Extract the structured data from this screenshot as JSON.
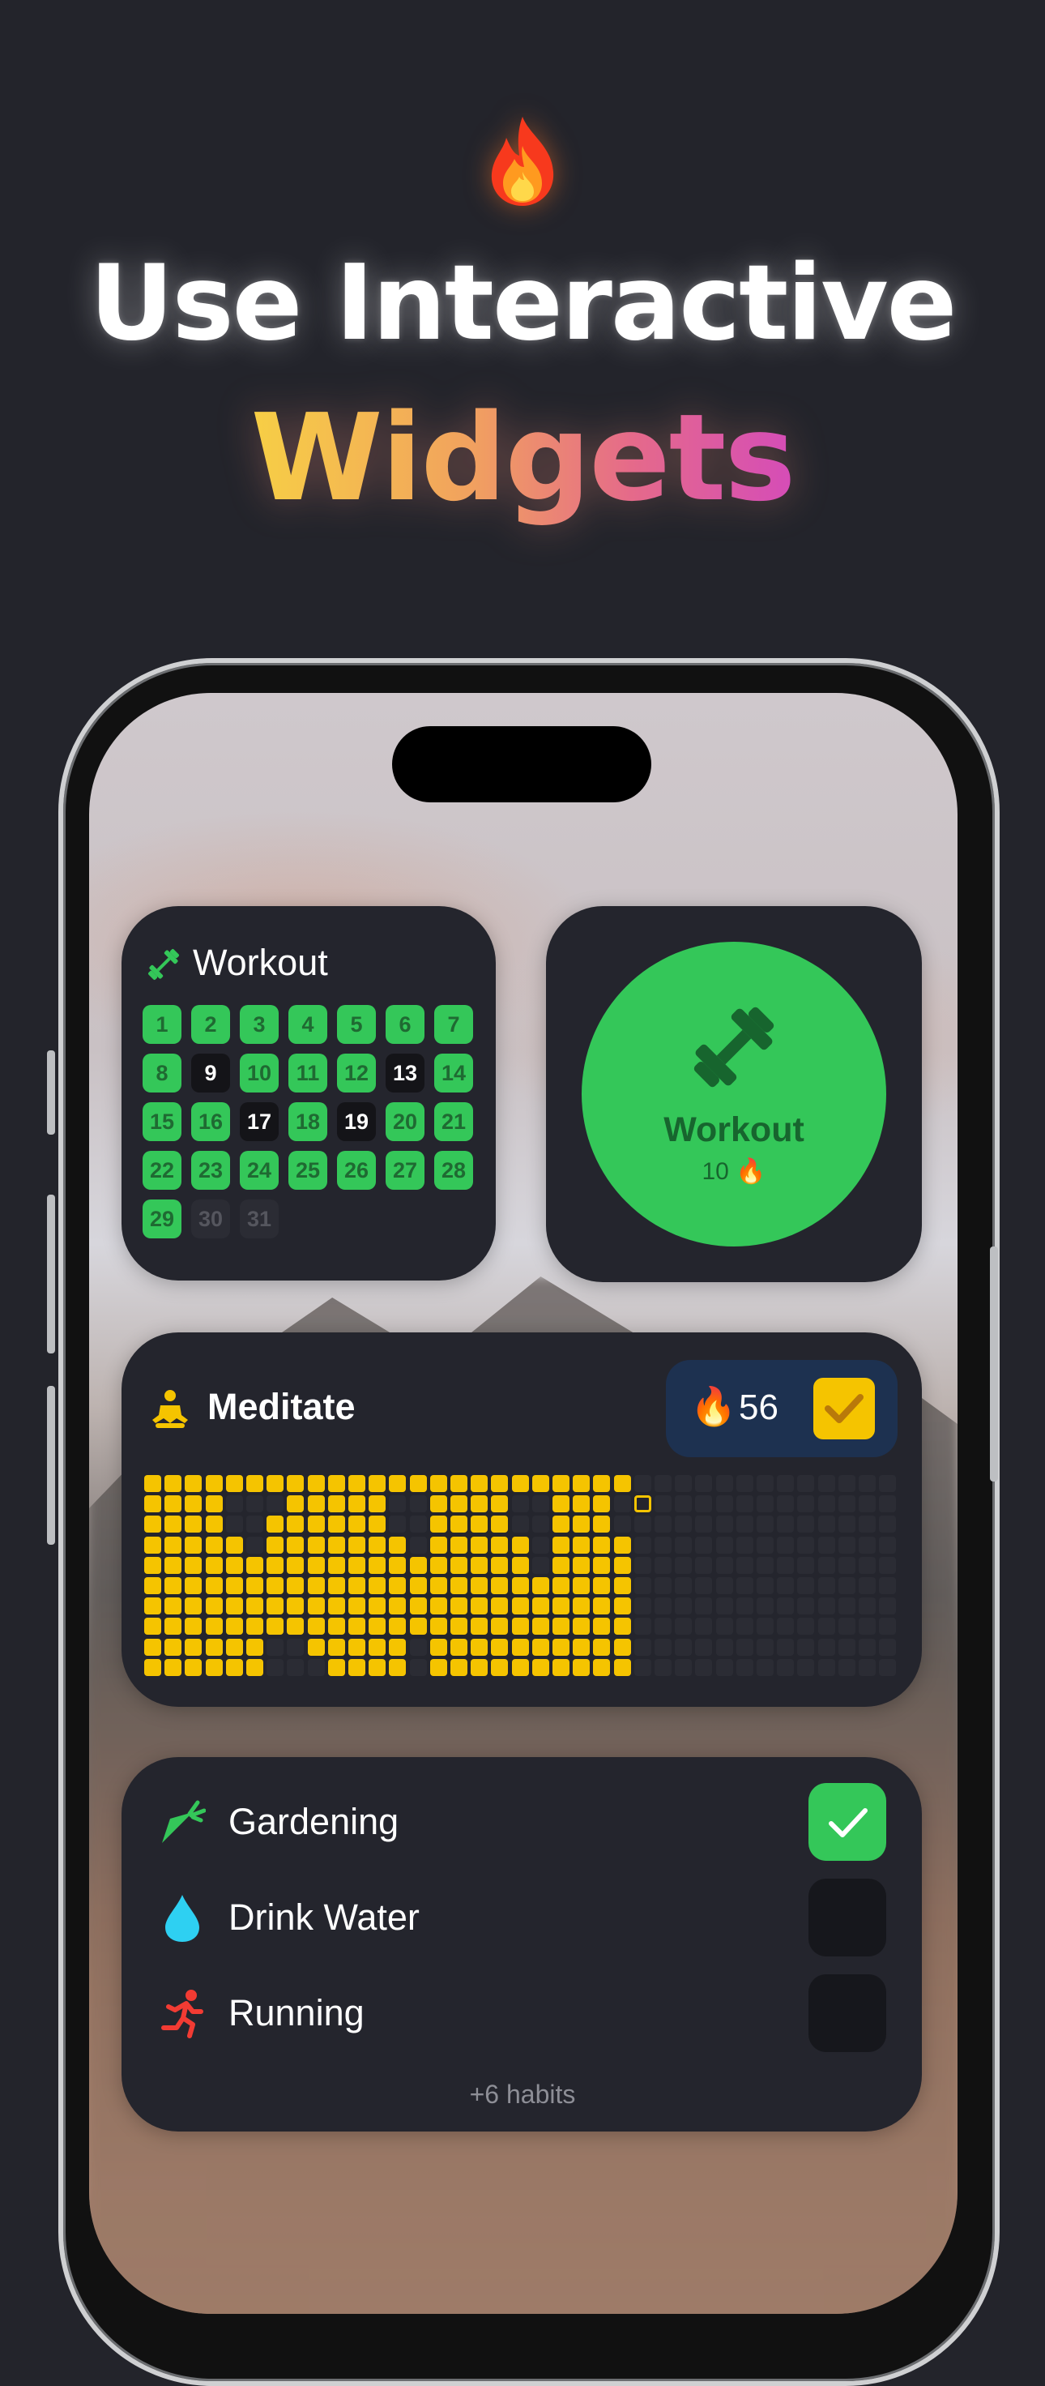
{
  "hero": {
    "emoji": "🔥",
    "line1": "Use Interactive",
    "line2": "Widgets"
  },
  "widgets": {
    "workout_calendar": {
      "title": "Workout",
      "icon": "dumbbell-icon",
      "days": [
        {
          "d": "1",
          "s": "done"
        },
        {
          "d": "2",
          "s": "done"
        },
        {
          "d": "3",
          "s": "done"
        },
        {
          "d": "4",
          "s": "done"
        },
        {
          "d": "5",
          "s": "done"
        },
        {
          "d": "6",
          "s": "done"
        },
        {
          "d": "7",
          "s": "done"
        },
        {
          "d": "8",
          "s": "done"
        },
        {
          "d": "9",
          "s": "miss"
        },
        {
          "d": "10",
          "s": "done"
        },
        {
          "d": "11",
          "s": "done"
        },
        {
          "d": "12",
          "s": "done"
        },
        {
          "d": "13",
          "s": "miss"
        },
        {
          "d": "14",
          "s": "done"
        },
        {
          "d": "15",
          "s": "done"
        },
        {
          "d": "16",
          "s": "done"
        },
        {
          "d": "17",
          "s": "miss"
        },
        {
          "d": "18",
          "s": "done"
        },
        {
          "d": "19",
          "s": "miss"
        },
        {
          "d": "20",
          "s": "done"
        },
        {
          "d": "21",
          "s": "done"
        },
        {
          "d": "22",
          "s": "done"
        },
        {
          "d": "23",
          "s": "done"
        },
        {
          "d": "24",
          "s": "done"
        },
        {
          "d": "25",
          "s": "done"
        },
        {
          "d": "26",
          "s": "done"
        },
        {
          "d": "27",
          "s": "done"
        },
        {
          "d": "28",
          "s": "done"
        },
        {
          "d": "29",
          "s": "done"
        },
        {
          "d": "30",
          "s": "future"
        },
        {
          "d": "31",
          "s": "future"
        }
      ]
    },
    "workout_button": {
      "title": "Workout",
      "streak": "10",
      "streak_icon": "🔥",
      "icon": "dumbbell-icon",
      "accent": "#34c759"
    },
    "meditate": {
      "title": "Meditate",
      "icon": "meditation-icon",
      "streak": "56",
      "streak_icon": "🔥",
      "checked": true,
      "accent": "#f5c400"
    },
    "checklist": {
      "items": [
        {
          "label": "Gardening",
          "icon": "carrot-icon",
          "checked": true
        },
        {
          "label": "Drink Water",
          "icon": "water-drop-icon",
          "checked": false
        },
        {
          "label": "Running",
          "icon": "running-icon",
          "checked": false
        }
      ],
      "more": "+6 habits"
    }
  },
  "colors": {
    "background": "#23242b",
    "widget_bg": "#24252d",
    "green": "#34c759",
    "yellow": "#f5c400",
    "gradient": [
      "#f7cf45",
      "#f1a25e",
      "#e56a8a",
      "#d54cb8"
    ]
  }
}
